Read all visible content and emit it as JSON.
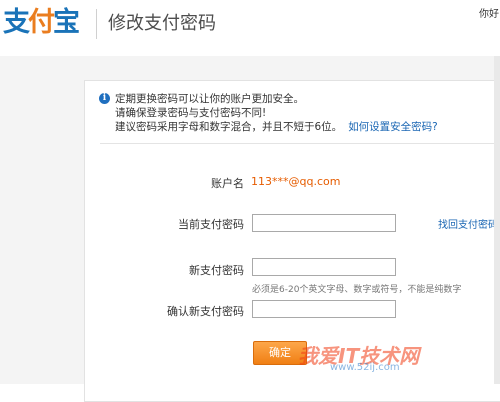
{
  "header": {
    "logo_chars": [
      "支",
      "付",
      "宝"
    ],
    "page_title": "修改支付密码",
    "greeting": "你好，"
  },
  "notice": {
    "line1": "定期更换密码可以让你的账户更加安全。",
    "line2": "请确保登录密码与支付密码不同!",
    "line3": "建议密码采用字母和数字混合，并且不短于6位。",
    "help_link": "如何设置安全密码?"
  },
  "form": {
    "account_label": "账户名",
    "account_value": "113***@qq.com",
    "current_pw_label": "当前支付密码",
    "retrieve_link": "找回支付密码",
    "new_pw_label": "新支付密码",
    "new_pw_hint": "必须是6-20个英文字母、数字或符号，不能是纯数字",
    "confirm_pw_label": "确认新支付密码",
    "submit_label": "确定"
  },
  "watermark": {
    "text": "我爱IT技术网",
    "url": "www.52ij.com"
  },
  "colors": {
    "brand_blue": "#1a73b8",
    "brand_orange": "#ea7d1f",
    "link_blue": "#1a66b3",
    "account_orange": "#e65c00",
    "button_orange": "#f08a1e"
  }
}
